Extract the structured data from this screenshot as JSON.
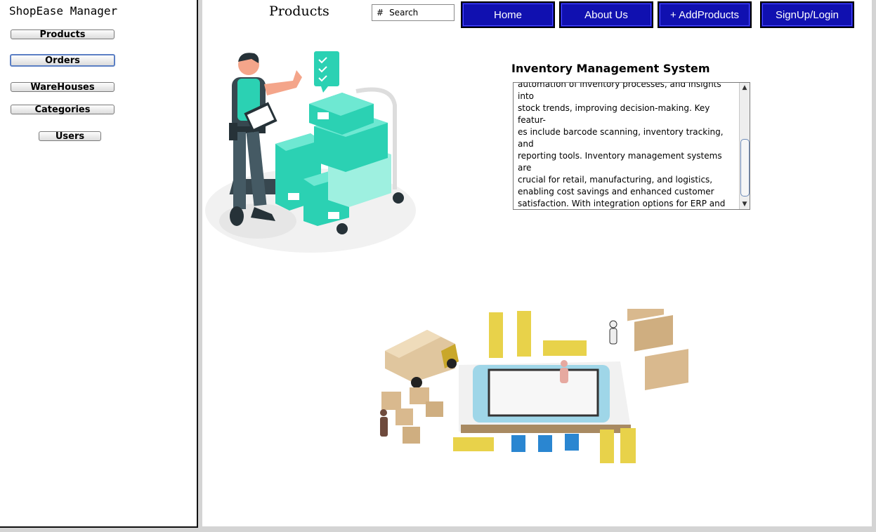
{
  "sidebar": {
    "app_title": "ShopEase Manager",
    "items": [
      {
        "label": "Products"
      },
      {
        "label": "Orders"
      },
      {
        "label": "WareHouses"
      },
      {
        "label": "Categories"
      },
      {
        "label": "Users"
      }
    ]
  },
  "header": {
    "page_title": "Products",
    "search": {
      "icon": "#",
      "placeholder": "Search"
    },
    "nav": [
      {
        "label": "Home"
      },
      {
        "label": "About Us"
      },
      {
        "label": "+  AddProducts"
      },
      {
        "label": "SignUp/Login"
      }
    ]
  },
  "main": {
    "heading": "Inventory Management System",
    "description": "automation of inventory processes, and insights into\nstock trends, improving decision-making. Key featur-\nes include barcode scanning, inventory tracking, and\nreporting tools. Inventory management systems are\n crucial for retail, manufacturing, and logistics,\n enabling cost savings and enhanced customer\nsatisfaction. With integration options for ERP and\nCRM systems, they streamline operations,\nreduce human error,\n and provide a competitive edge in managing supply\nchains effectively."
  },
  "colors": {
    "nav_button_bg": "#1010b0",
    "box_teal": "#2bd1b3",
    "block_yellow": "#e8d24a",
    "block_blue": "#2a86d1"
  }
}
